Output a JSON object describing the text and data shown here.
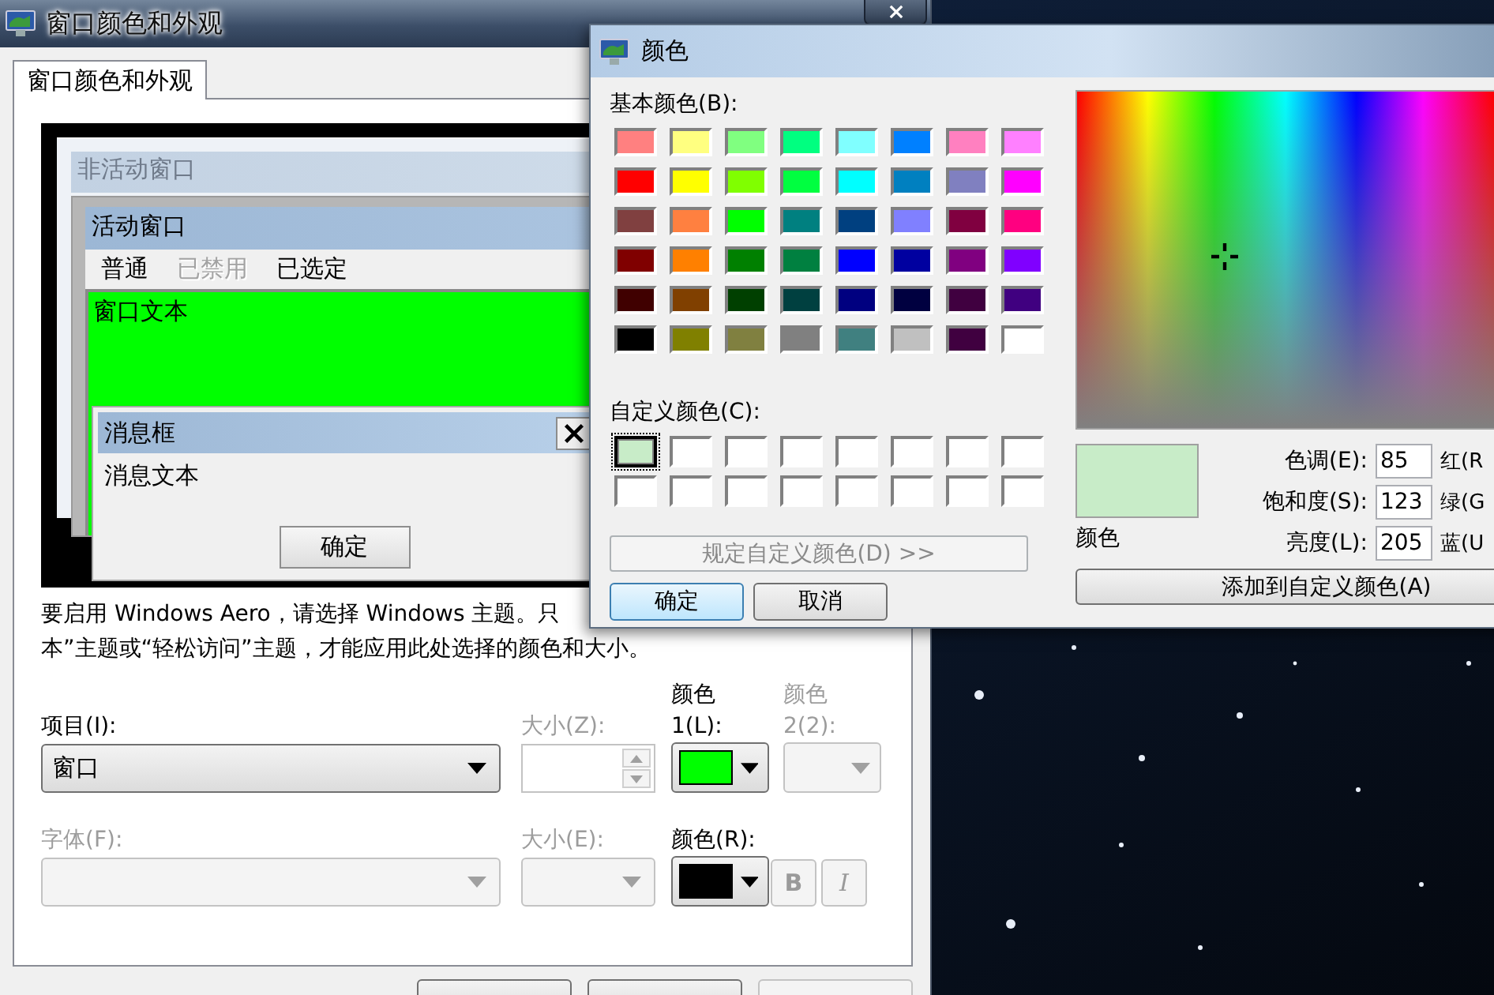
{
  "appearance_window": {
    "title": "窗口颜色和外观",
    "tabs": [
      {
        "label": "窗口颜色和外观",
        "selected": true
      }
    ],
    "preview": {
      "inactive_title": "非活动窗口",
      "active_title": "活动窗口",
      "menu": [
        {
          "label": "普通",
          "disabled": false
        },
        {
          "label": "已禁用",
          "disabled": true
        },
        {
          "label": "已选定",
          "disabled": false
        }
      ],
      "window_text": "窗口文本",
      "message_title": "消息框",
      "message_text": "消息文本",
      "message_button": "确定"
    },
    "notice": [
      "要启用 Windows Aero，请选择 Windows 主题。只",
      "本”主题或“轻松访问”主题，才能应用此处选择的颜色和大小。"
    ],
    "item": {
      "label": "项目(I):",
      "value": "窗口"
    },
    "item_size": {
      "label": "大小(Z):",
      "disabled": true
    },
    "color_1": {
      "label": "颜色 1(L):",
      "color": "#00ff00",
      "disabled": false
    },
    "color_2": {
      "label": "颜色 2(2):",
      "disabled": true
    },
    "font": {
      "label": "字体(F):",
      "disabled": true
    },
    "font_size": {
      "label": "大小(E):",
      "disabled": true
    },
    "font_color": {
      "label": "颜色(R):",
      "color": "#000000",
      "disabled": false
    },
    "style_buttons": [
      {
        "label": "B",
        "kind": "bold",
        "disabled": true
      },
      {
        "label": "I",
        "kind": "italic",
        "disabled": true
      }
    ],
    "bottom_buttons": [
      {
        "disabled": false
      },
      {
        "disabled": false
      },
      {
        "disabled": true
      }
    ]
  },
  "color_dialog": {
    "title": "颜色",
    "basic_label": "基本颜色(B):",
    "basic_colors": [
      {
        "color": "#ff8080"
      },
      {
        "color": "#ffff80"
      },
      {
        "color": "#80ff80"
      },
      {
        "color": "#00ff80"
      },
      {
        "color": "#80ffff"
      },
      {
        "color": "#0080ff"
      },
      {
        "color": "#ff80c0"
      },
      {
        "color": "#ff80ff"
      },
      {
        "color": "#ff0000"
      },
      {
        "color": "#ffff00"
      },
      {
        "color": "#80ff00"
      },
      {
        "color": "#00ff40"
      },
      {
        "color": "#00ffff"
      },
      {
        "color": "#0080c0"
      },
      {
        "color": "#8080c0"
      },
      {
        "color": "#ff00ff"
      },
      {
        "color": "#804040"
      },
      {
        "color": "#ff8040"
      },
      {
        "color": "#00ff00"
      },
      {
        "color": "#008080"
      },
      {
        "color": "#004080"
      },
      {
        "color": "#8080ff"
      },
      {
        "color": "#800040"
      },
      {
        "color": "#ff0080"
      },
      {
        "color": "#800000"
      },
      {
        "color": "#ff8000"
      },
      {
        "color": "#008000"
      },
      {
        "color": "#008040"
      },
      {
        "color": "#0000ff"
      },
      {
        "color": "#0000a0"
      },
      {
        "color": "#800080"
      },
      {
        "color": "#8000ff"
      },
      {
        "color": "#400000"
      },
      {
        "color": "#804000"
      },
      {
        "color": "#004000"
      },
      {
        "color": "#004040"
      },
      {
        "color": "#000080"
      },
      {
        "color": "#000040"
      },
      {
        "color": "#400040"
      },
      {
        "color": "#400080"
      },
      {
        "color": "#000000"
      },
      {
        "color": "#808000"
      },
      {
        "color": "#808040"
      },
      {
        "color": "#808080"
      },
      {
        "color": "#408080"
      },
      {
        "color": "#c0c0c0"
      },
      {
        "color": "#400040"
      },
      {
        "color": "#ffffff"
      }
    ],
    "custom_label": "自定义颜色(C):",
    "custom_colors": [
      {
        "color": "#c8ecc8",
        "selected": true
      },
      {
        "color": "#ffffff",
        "selected": false
      },
      {
        "color": "#ffffff",
        "selected": false
      },
      {
        "color": "#ffffff",
        "selected": false
      },
      {
        "color": "#ffffff",
        "selected": false
      },
      {
        "color": "#ffffff",
        "selected": false
      },
      {
        "color": "#ffffff",
        "selected": false
      },
      {
        "color": "#ffffff",
        "selected": false
      },
      {
        "color": "#ffffff",
        "selected": false
      },
      {
        "color": "#ffffff",
        "selected": false
      },
      {
        "color": "#ffffff",
        "selected": false
      },
      {
        "color": "#ffffff",
        "selected": false
      },
      {
        "color": "#ffffff",
        "selected": false
      },
      {
        "color": "#ffffff",
        "selected": false
      },
      {
        "color": "#ffffff",
        "selected": false
      },
      {
        "color": "#ffffff",
        "selected": false
      }
    ],
    "define_button": {
      "label": "规定自定义颜色(D) >>",
      "disabled": true
    },
    "ok_button": "确定",
    "cancel_button": "取消",
    "preview": {
      "color": "#c8ecc8",
      "label": "颜色"
    },
    "fields": [
      {
        "label": "色调(E):",
        "value": "85",
        "channel": "红(R"
      },
      {
        "label": "饱和度(S):",
        "value": "123",
        "channel": "绿(G"
      },
      {
        "label": "亮度(L):",
        "value": "205",
        "channel": "蓝(U"
      }
    ],
    "add_button": "添加到自定义颜色(A)"
  }
}
